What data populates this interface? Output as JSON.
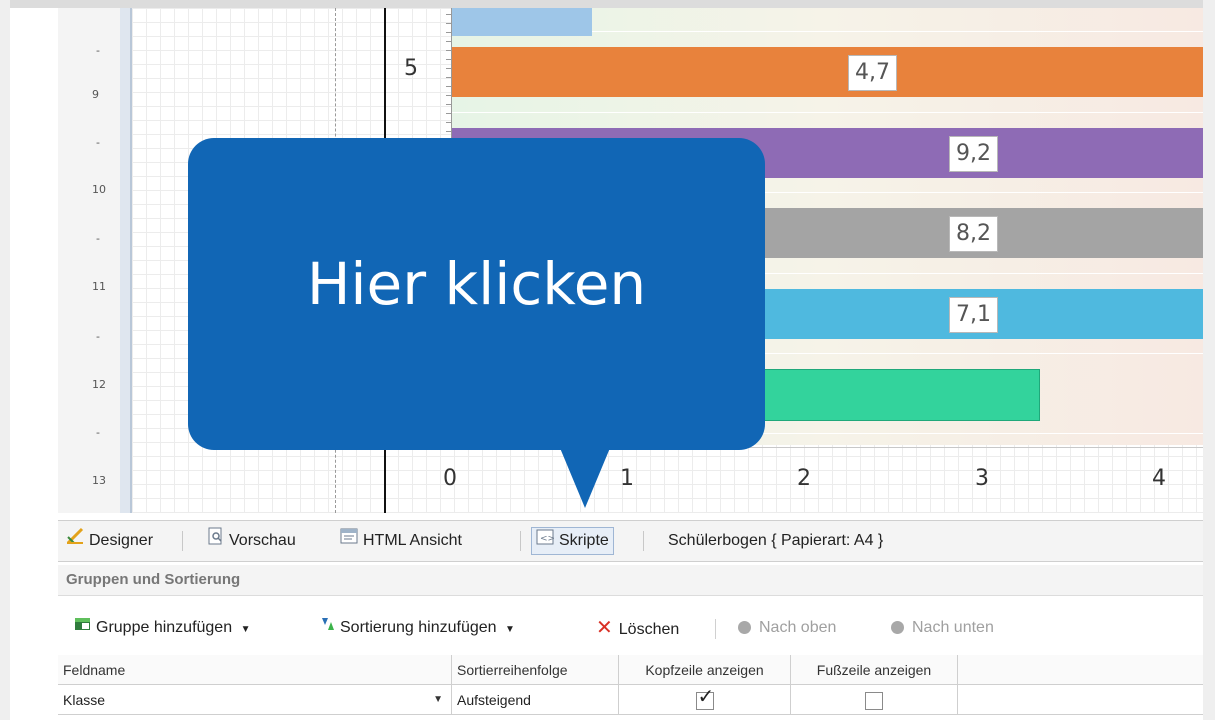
{
  "ruler": {
    "labels": [
      {
        "text": "-",
        "kind": "dash"
      },
      {
        "text": "9",
        "kind": "num"
      },
      {
        "text": "-",
        "kind": "dash"
      },
      {
        "text": "10",
        "kind": "num"
      },
      {
        "text": "-",
        "kind": "dash"
      },
      {
        "text": "11",
        "kind": "num"
      },
      {
        "text": "-",
        "kind": "dash"
      },
      {
        "text": "12",
        "kind": "num"
      },
      {
        "text": "-",
        "kind": "dash"
      },
      {
        "text": "13",
        "kind": "num"
      }
    ]
  },
  "chart_data": {
    "type": "bar",
    "orientation": "horizontal",
    "y_tick_label": "5",
    "x_ticks": [
      "0",
      "1",
      "2",
      "3",
      "4"
    ],
    "xlim": [
      0,
      4.25
    ],
    "bars": [
      {
        "value": 0.8,
        "label": "",
        "color": "#9ec6e8"
      },
      {
        "value": 4.7,
        "label": "4,7",
        "color": "#e8823c"
      },
      {
        "value": 9.2,
        "label": "9,2",
        "color": "#8e6bb5"
      },
      {
        "value": 8.2,
        "label": "8,2",
        "color": "#a4a4a4"
      },
      {
        "value": 7.1,
        "label": "7,1",
        "color": "#4fb9df"
      },
      {
        "value": 3.35,
        "label": "",
        "color": "#33d39c"
      }
    ]
  },
  "callout": {
    "text": "Hier klicken",
    "color": "#1166b5"
  },
  "tabs": {
    "designer": "Designer",
    "vorschau": "Vorschau",
    "html": "HTML Ansicht",
    "skripte": "Skripte",
    "doc_info": "Schülerbogen { Papierart: A4 }"
  },
  "panel": {
    "title": "Gruppen und Sortierung",
    "add_group": "Gruppe hinzufügen",
    "add_sort": "Sortierung hinzufügen",
    "delete": "Löschen",
    "move_up": "Nach oben",
    "move_down": "Nach unten"
  },
  "table": {
    "headers": [
      "Feldname",
      "Sortierreihenfolge",
      "Kopfzeile anzeigen",
      "Fußzeile anzeigen"
    ],
    "rows": [
      {
        "feldname": "Klasse",
        "sortierung": "Aufsteigend",
        "kopfzeile": true,
        "fusszeile": false
      }
    ]
  }
}
